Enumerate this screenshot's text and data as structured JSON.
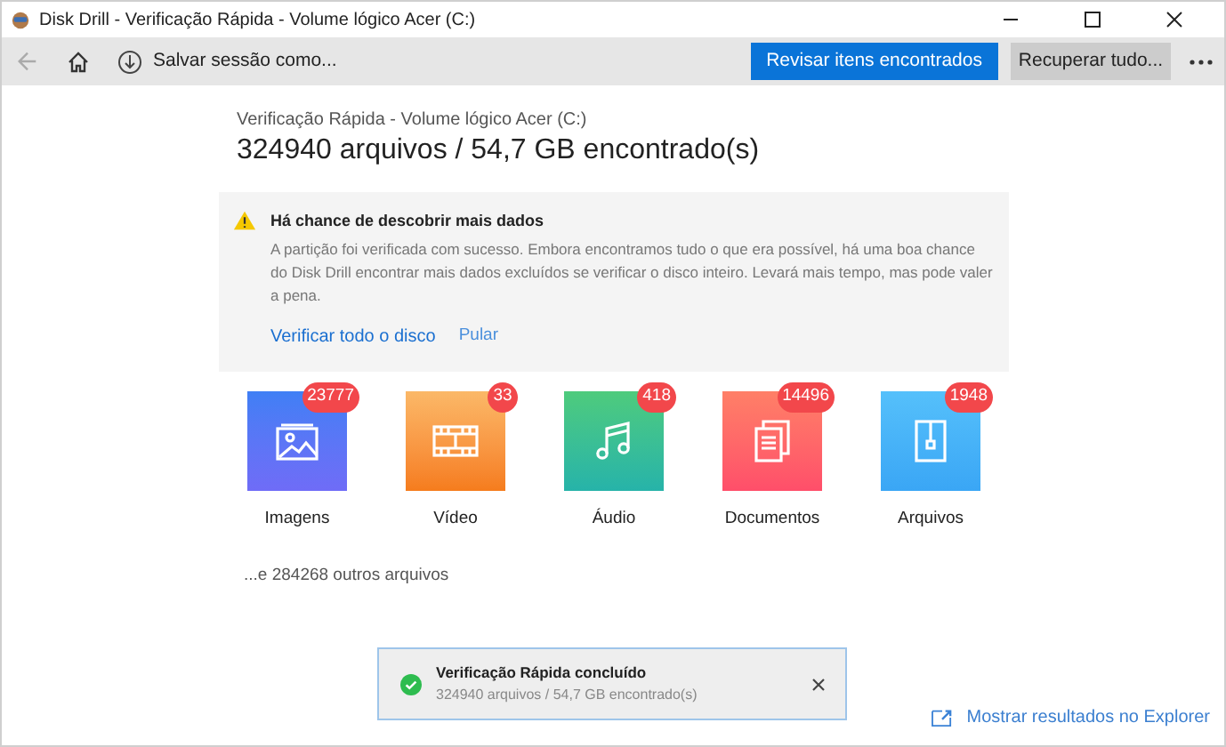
{
  "window": {
    "title": "Disk Drill - Verificação Rápida - Volume lógico Acer (C:)"
  },
  "toolbar": {
    "save_session": "Salvar sessão como...",
    "review_button": "Revisar itens encontrados",
    "recover_button": "Recuperar tudo..."
  },
  "scan": {
    "subtitle": "Verificação Rápida - Volume lógico Acer (C:)",
    "summary": "324940 arquivos / 54,7 GB encontrado(s)"
  },
  "notice": {
    "title": "Há chance de descobrir mais dados",
    "body": "A partição foi verificada com sucesso. Embora encontramos tudo o que era possível, há uma boa chance do Disk Drill encontrar mais dados excluídos se verificar o disco inteiro. Levará mais tempo, mas pode valer a pena.",
    "links": [
      "Verificar todo o disco",
      "Pular"
    ]
  },
  "categories": [
    {
      "kind": "images",
      "label": "Imagens",
      "count": "23777"
    },
    {
      "kind": "video",
      "label": "Vídeo",
      "count": "33"
    },
    {
      "kind": "audio",
      "label": "Áudio",
      "count": "418"
    },
    {
      "kind": "documents",
      "label": "Documentos",
      "count": "14496"
    },
    {
      "kind": "archives",
      "label": "Arquivos",
      "count": "1948"
    }
  ],
  "others": "...e 284268 outros arquivos",
  "toast": {
    "title": "Verificação Rápida concluído",
    "detail": "324940 arquivos / 54,7 GB encontrado(s)"
  },
  "explorer_link": "Mostrar resultados no Explorer"
}
